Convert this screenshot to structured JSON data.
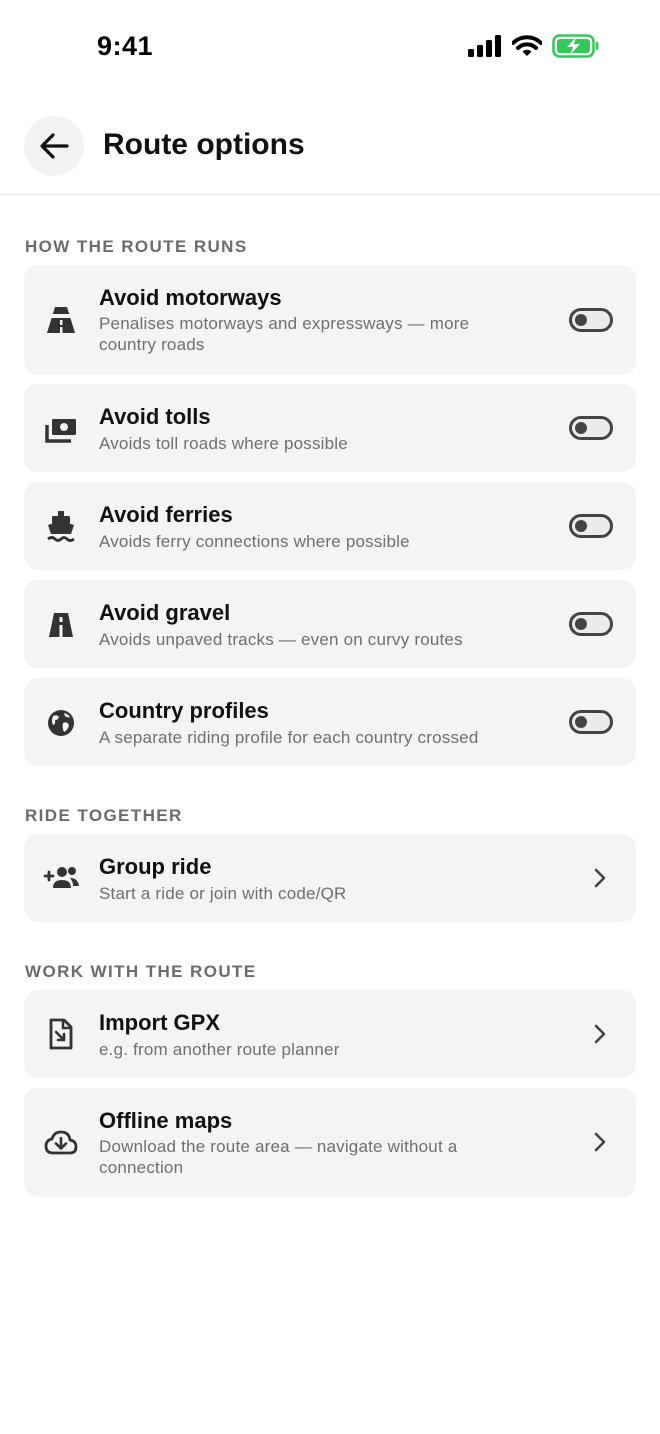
{
  "status_bar": {
    "time": "9:41",
    "icons": [
      "signal-icon",
      "wifi-icon",
      "battery-charging-icon"
    ],
    "battery_color": "#34c759"
  },
  "header": {
    "title": "Route options",
    "back_icon": "arrow-left-icon"
  },
  "sections": {
    "route": {
      "title": "HOW THE ROUTE RUNS",
      "items": [
        {
          "title": "Avoid motorways",
          "subtitle": "Penalises motorways and expressways — more country roads",
          "icon": "motorway-icon",
          "enabled": false
        },
        {
          "title": "Avoid tolls",
          "subtitle": "Avoids toll roads where possible",
          "icon": "toll-icon",
          "enabled": false
        },
        {
          "title": "Avoid ferries",
          "subtitle": "Avoids ferry connections where possible",
          "icon": "ferry-icon",
          "enabled": false
        },
        {
          "title": "Avoid gravel",
          "subtitle": "Avoids unpaved tracks — even on curvy routes",
          "icon": "gravel-road-icon",
          "enabled": false
        },
        {
          "title": "Country profiles",
          "subtitle": "A separate riding profile for each country crossed",
          "icon": "globe-icon",
          "enabled": false
        }
      ]
    },
    "together": {
      "title": "RIDE TOGETHER",
      "items": [
        {
          "title": "Group ride",
          "subtitle": "Start a ride or join with code/QR",
          "icon": "group-add-icon"
        }
      ]
    },
    "work": {
      "title": "WORK WITH THE ROUTE",
      "items": [
        {
          "title": "Import GPX",
          "subtitle": "e.g. from another route planner",
          "icon": "file-import-icon"
        },
        {
          "title": "Offline maps",
          "subtitle": "Download the route area — navigate without a connection",
          "icon": "cloud-download-icon"
        }
      ]
    }
  }
}
